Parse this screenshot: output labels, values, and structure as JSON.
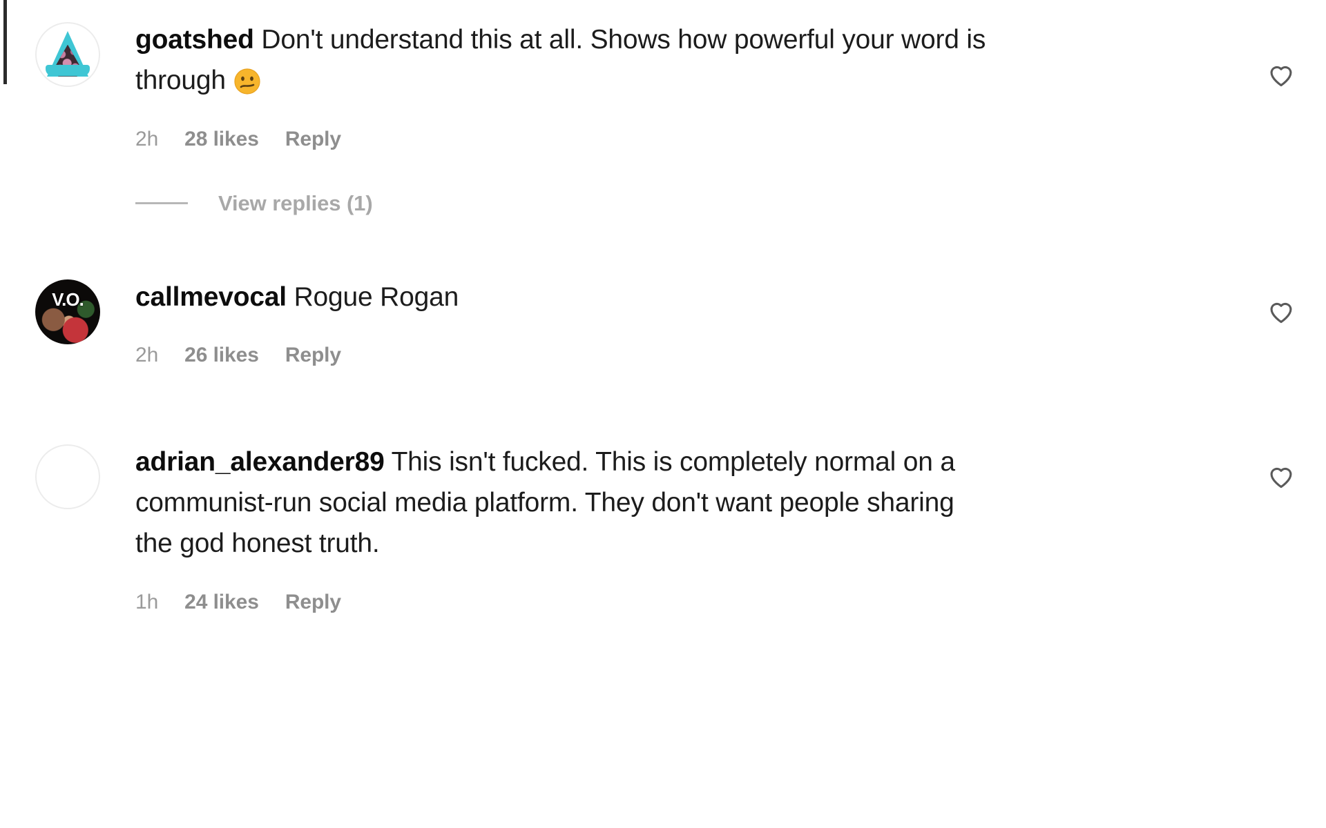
{
  "app": {
    "name": "instagram-comments",
    "background_color": "#ffffff",
    "text_color": "#1c1c1c",
    "meta_color": "#8e8e8e"
  },
  "comments": [
    {
      "username": "goatshed",
      "text": "Don't understand this at all. Shows how powerful your word is through ",
      "emoji": "😕",
      "emoji_name": "confused-face-emoji",
      "time": "2h",
      "likes": "28 likes",
      "reply_label": "Reply",
      "like_icon": "heart-outline-icon",
      "avatar_name": "avatar-goatshed",
      "view_replies": "View replies (1)",
      "has_replies": true
    },
    {
      "username": "callmevocal",
      "text": "Rogue Rogan",
      "emoji": "",
      "emoji_name": "",
      "time": "2h",
      "likes": "26 likes",
      "reply_label": "Reply",
      "like_icon": "heart-outline-icon",
      "avatar_name": "avatar-callmevocal",
      "avatar_overlay_text": "V.O.",
      "view_replies": "",
      "has_replies": false
    },
    {
      "username": "adrian_alexander89",
      "text": "This isn't fucked. This is completely normal on a communist-run social media platform. They don't want people sharing the god honest truth.",
      "emoji": "",
      "emoji_name": "",
      "time": "1h",
      "likes": "24 likes",
      "reply_label": "Reply",
      "like_icon": "heart-outline-icon",
      "avatar_name": "avatar-adrian",
      "view_replies": "",
      "has_replies": false
    }
  ]
}
